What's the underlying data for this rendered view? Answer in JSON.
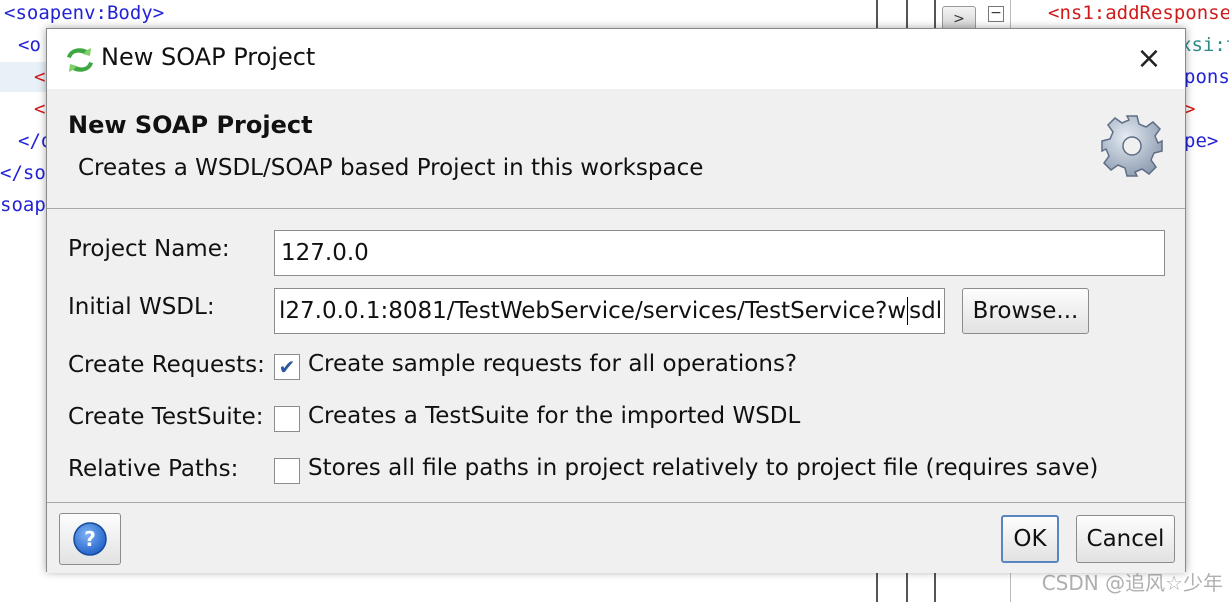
{
  "background": {
    "left_lines": [
      {
        "text": "<soapenv:Body>",
        "color": "#2323d6"
      },
      {
        "text": "<o",
        "color": "#2323d6"
      },
      {
        "text": "<",
        "color": "#d11a1a"
      },
      {
        "text": "<",
        "color": "#d11a1a"
      },
      {
        "text": "</o",
        "color": "#2323d6"
      },
      {
        "text": "</soa",
        "color": "#2323d6"
      },
      {
        "text": "soap",
        "color": "#2323d6"
      }
    ],
    "right_lines": [
      {
        "text": "<ns1:addResponse",
        "color": "#d11a1a"
      },
      {
        "text": "xsi:ty",
        "color": "#2a8a8a"
      },
      {
        "text": "pons",
        "color": "#2323d6"
      },
      {
        "text": ">",
        "color": "#d11a1a"
      },
      {
        "text": "pe>",
        "color": "#2323d6"
      }
    ],
    "gutter_button": ">",
    "gutter_collapse": "−",
    "watermark": "CSDN @追风☆少年"
  },
  "dialog": {
    "title": "New SOAP Project",
    "close_icon": "×",
    "header_title": "New SOAP Project",
    "header_description": "Creates a WSDL/SOAP based Project in this workspace",
    "fields": {
      "project_name_label": "Project Name:",
      "project_name_value": "127.0.0",
      "initial_wsdl_label": "Initial WSDL:",
      "initial_wsdl_value_before_caret": "l27.0.0.1:8081/TestWebService/services/TestService?w",
      "initial_wsdl_value_after_caret": "sdl",
      "browse_label": "Browse...",
      "create_requests_label": "Create Requests:",
      "create_requests_text": "Create sample requests for all operations?",
      "create_requests_checked": true,
      "create_testsuite_label": "Create TestSuite:",
      "create_testsuite_text": "Creates a TestSuite for the imported WSDL",
      "create_testsuite_checked": false,
      "relative_paths_label": "Relative Paths:",
      "relative_paths_text": "Stores all file paths in project relatively to project file (requires save)",
      "relative_paths_checked": false
    },
    "footer": {
      "ok_label": "OK",
      "cancel_label": "Cancel"
    },
    "colors": {
      "accent": "#5a86c0",
      "help_icon": "#2b6fd6"
    }
  }
}
